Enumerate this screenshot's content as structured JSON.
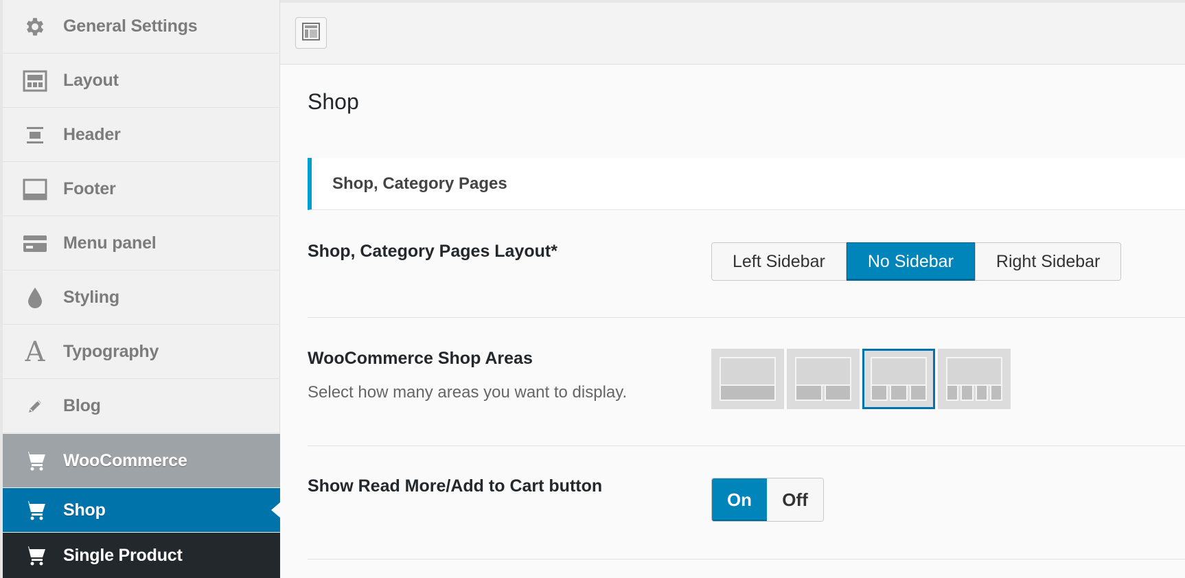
{
  "sidebar": {
    "items": [
      {
        "label": "General Settings",
        "icon": "gear-icon"
      },
      {
        "label": "Layout",
        "icon": "layout-icon"
      },
      {
        "label": "Header",
        "icon": "header-icon"
      },
      {
        "label": "Footer",
        "icon": "footer-icon"
      },
      {
        "label": "Menu panel",
        "icon": "menu-panel-icon"
      },
      {
        "label": "Styling",
        "icon": "droplet-icon"
      },
      {
        "label": "Typography",
        "icon": "typography-icon"
      },
      {
        "label": "Blog",
        "icon": "pencil-icon"
      },
      {
        "label": "WooCommerce",
        "icon": "cart-icon"
      },
      {
        "label": "Shop",
        "icon": "cart-icon"
      },
      {
        "label": "Single Product",
        "icon": "cart-icon"
      }
    ],
    "active_color": "#0073aa"
  },
  "main": {
    "title": "Shop",
    "section": "Shop, Category Pages",
    "layout_setting": {
      "label": "Shop, Category Pages Layout*",
      "options": [
        "Left Sidebar",
        "No Sidebar",
        "Right Sidebar"
      ],
      "selected": "No Sidebar"
    },
    "areas_setting": {
      "label": "WooCommerce Shop Areas",
      "description": "Select how many areas you want to display.",
      "options": [
        1,
        2,
        3,
        4
      ],
      "selected": 3
    },
    "read_more_setting": {
      "label": "Show Read More/Add to Cart button",
      "on_label": "On",
      "off_label": "Off",
      "value": "On"
    }
  }
}
